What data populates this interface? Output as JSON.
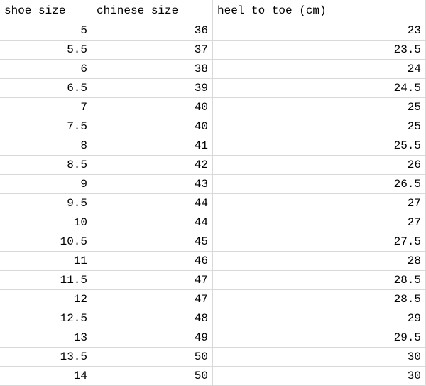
{
  "headers": {
    "shoe_size": "shoe size",
    "chinese_size": "chinese size",
    "heel_to_toe": "heel to toe (cm)"
  },
  "rows": [
    {
      "shoe_size": "5",
      "chinese_size": "36",
      "heel_to_toe": "23"
    },
    {
      "shoe_size": "5.5",
      "chinese_size": "37",
      "heel_to_toe": "23.5"
    },
    {
      "shoe_size": "6",
      "chinese_size": "38",
      "heel_to_toe": "24"
    },
    {
      "shoe_size": "6.5",
      "chinese_size": "39",
      "heel_to_toe": "24.5"
    },
    {
      "shoe_size": "7",
      "chinese_size": "40",
      "heel_to_toe": "25"
    },
    {
      "shoe_size": "7.5",
      "chinese_size": "40",
      "heel_to_toe": "25"
    },
    {
      "shoe_size": "8",
      "chinese_size": "41",
      "heel_to_toe": "25.5"
    },
    {
      "shoe_size": "8.5",
      "chinese_size": "42",
      "heel_to_toe": "26"
    },
    {
      "shoe_size": "9",
      "chinese_size": "43",
      "heel_to_toe": "26.5"
    },
    {
      "shoe_size": "9.5",
      "chinese_size": "44",
      "heel_to_toe": "27"
    },
    {
      "shoe_size": "10",
      "chinese_size": "44",
      "heel_to_toe": "27"
    },
    {
      "shoe_size": "10.5",
      "chinese_size": "45",
      "heel_to_toe": "27.5"
    },
    {
      "shoe_size": "11",
      "chinese_size": "46",
      "heel_to_toe": "28"
    },
    {
      "shoe_size": "11.5",
      "chinese_size": "47",
      "heel_to_toe": "28.5"
    },
    {
      "shoe_size": "12",
      "chinese_size": "47",
      "heel_to_toe": "28.5"
    },
    {
      "shoe_size": "12.5",
      "chinese_size": "48",
      "heel_to_toe": "29"
    },
    {
      "shoe_size": "13",
      "chinese_size": "49",
      "heel_to_toe": "29.5"
    },
    {
      "shoe_size": "13.5",
      "chinese_size": "50",
      "heel_to_toe": "30"
    },
    {
      "shoe_size": "14",
      "chinese_size": "50",
      "heel_to_toe": "30"
    }
  ],
  "chart_data": {
    "type": "table",
    "title": "",
    "columns": [
      "shoe size",
      "chinese size",
      "heel to toe (cm)"
    ],
    "data": [
      [
        5,
        36,
        23
      ],
      [
        5.5,
        37,
        23.5
      ],
      [
        6,
        38,
        24
      ],
      [
        6.5,
        39,
        24.5
      ],
      [
        7,
        40,
        25
      ],
      [
        7.5,
        40,
        25
      ],
      [
        8,
        41,
        25.5
      ],
      [
        8.5,
        42,
        26
      ],
      [
        9,
        43,
        26.5
      ],
      [
        9.5,
        44,
        27
      ],
      [
        10,
        44,
        27
      ],
      [
        10.5,
        45,
        27.5
      ],
      [
        11,
        46,
        28
      ],
      [
        11.5,
        47,
        28.5
      ],
      [
        12,
        47,
        28.5
      ],
      [
        12.5,
        48,
        29
      ],
      [
        13,
        49,
        29.5
      ],
      [
        13.5,
        50,
        30
      ],
      [
        14,
        50,
        30
      ]
    ]
  }
}
